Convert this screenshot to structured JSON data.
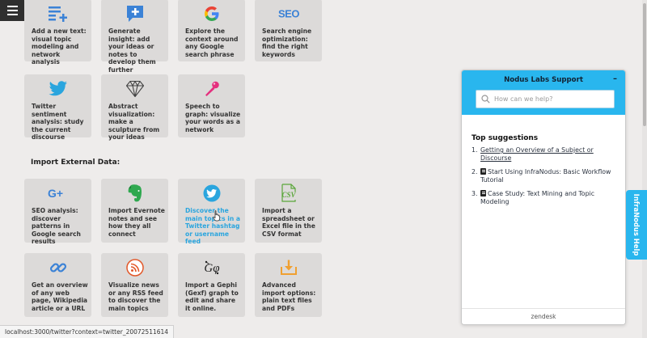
{
  "status_url": "localhost:3000/twitter?context=twitter_20072511614",
  "section_title": "Import External Data:",
  "cards_row1": [
    {
      "icon": "add-text-icon",
      "label": "Add a new text: visual topic modeling and network analysis"
    },
    {
      "icon": "add-insight-icon",
      "label": "Generate insight: add your ideas or notes to develop them further"
    },
    {
      "icon": "google-icon",
      "label": "Explore the context around any Google search phrase"
    },
    {
      "icon": "seo-icon",
      "label": "Search engine optimization: find the right keywords"
    }
  ],
  "cards_row2": [
    {
      "icon": "twitter-icon",
      "label": "Twitter sentiment analysis: study the current discourse"
    },
    {
      "icon": "diamond-icon",
      "label": "Abstract visualization: make a sculpture from your ideas"
    },
    {
      "icon": "microphone-icon",
      "label": "Speech to graph: visualize your words as a network"
    }
  ],
  "cards_row3": [
    {
      "icon": "google-plus-icon",
      "label": "SEO analysis: discover patterns in Google search results"
    },
    {
      "icon": "evernote-icon",
      "label": "Import Evernote notes and see how they all connect"
    },
    {
      "icon": "twitter-circle-icon",
      "label": "Discover the main topics in a Twitter hashtag or username feed"
    },
    {
      "icon": "csv-icon",
      "label": "Import a spreadsheet or Excel file in the CSV format"
    }
  ],
  "cards_row4": [
    {
      "icon": "link-icon",
      "label": "Get an overview of any web page, Wikipedia article or a URL"
    },
    {
      "icon": "rss-icon",
      "label": "Visualize news or any RSS feed to discover the main topics"
    },
    {
      "icon": "gephi-icon",
      "label": "Import a Gephi (Gexf) graph to edit and share it online."
    },
    {
      "icon": "import-icon",
      "label": "Advanced import options: plain text files and PDFs"
    }
  ],
  "support": {
    "title": "Nodus Labs Support",
    "minimize": "–",
    "search_placeholder": "How can we help?",
    "suggestions_title": "Top suggestions",
    "suggestions": [
      {
        "num": "1.",
        "label": "Getting an Overview of a Subject or Discourse"
      },
      {
        "num": "2.",
        "label": "Start Using InfraNodus: Basic Workflow Tutorial"
      },
      {
        "num": "3.",
        "label": "Case Study: Text Mining and Topic Modeling"
      }
    ],
    "footer": "zendesk"
  },
  "help_tab": "InfraNodus Help",
  "colors": {
    "accent": "#29b6ee",
    "card": "#dcdad9",
    "background": "#eeeceb",
    "link": "#2aa5de"
  }
}
